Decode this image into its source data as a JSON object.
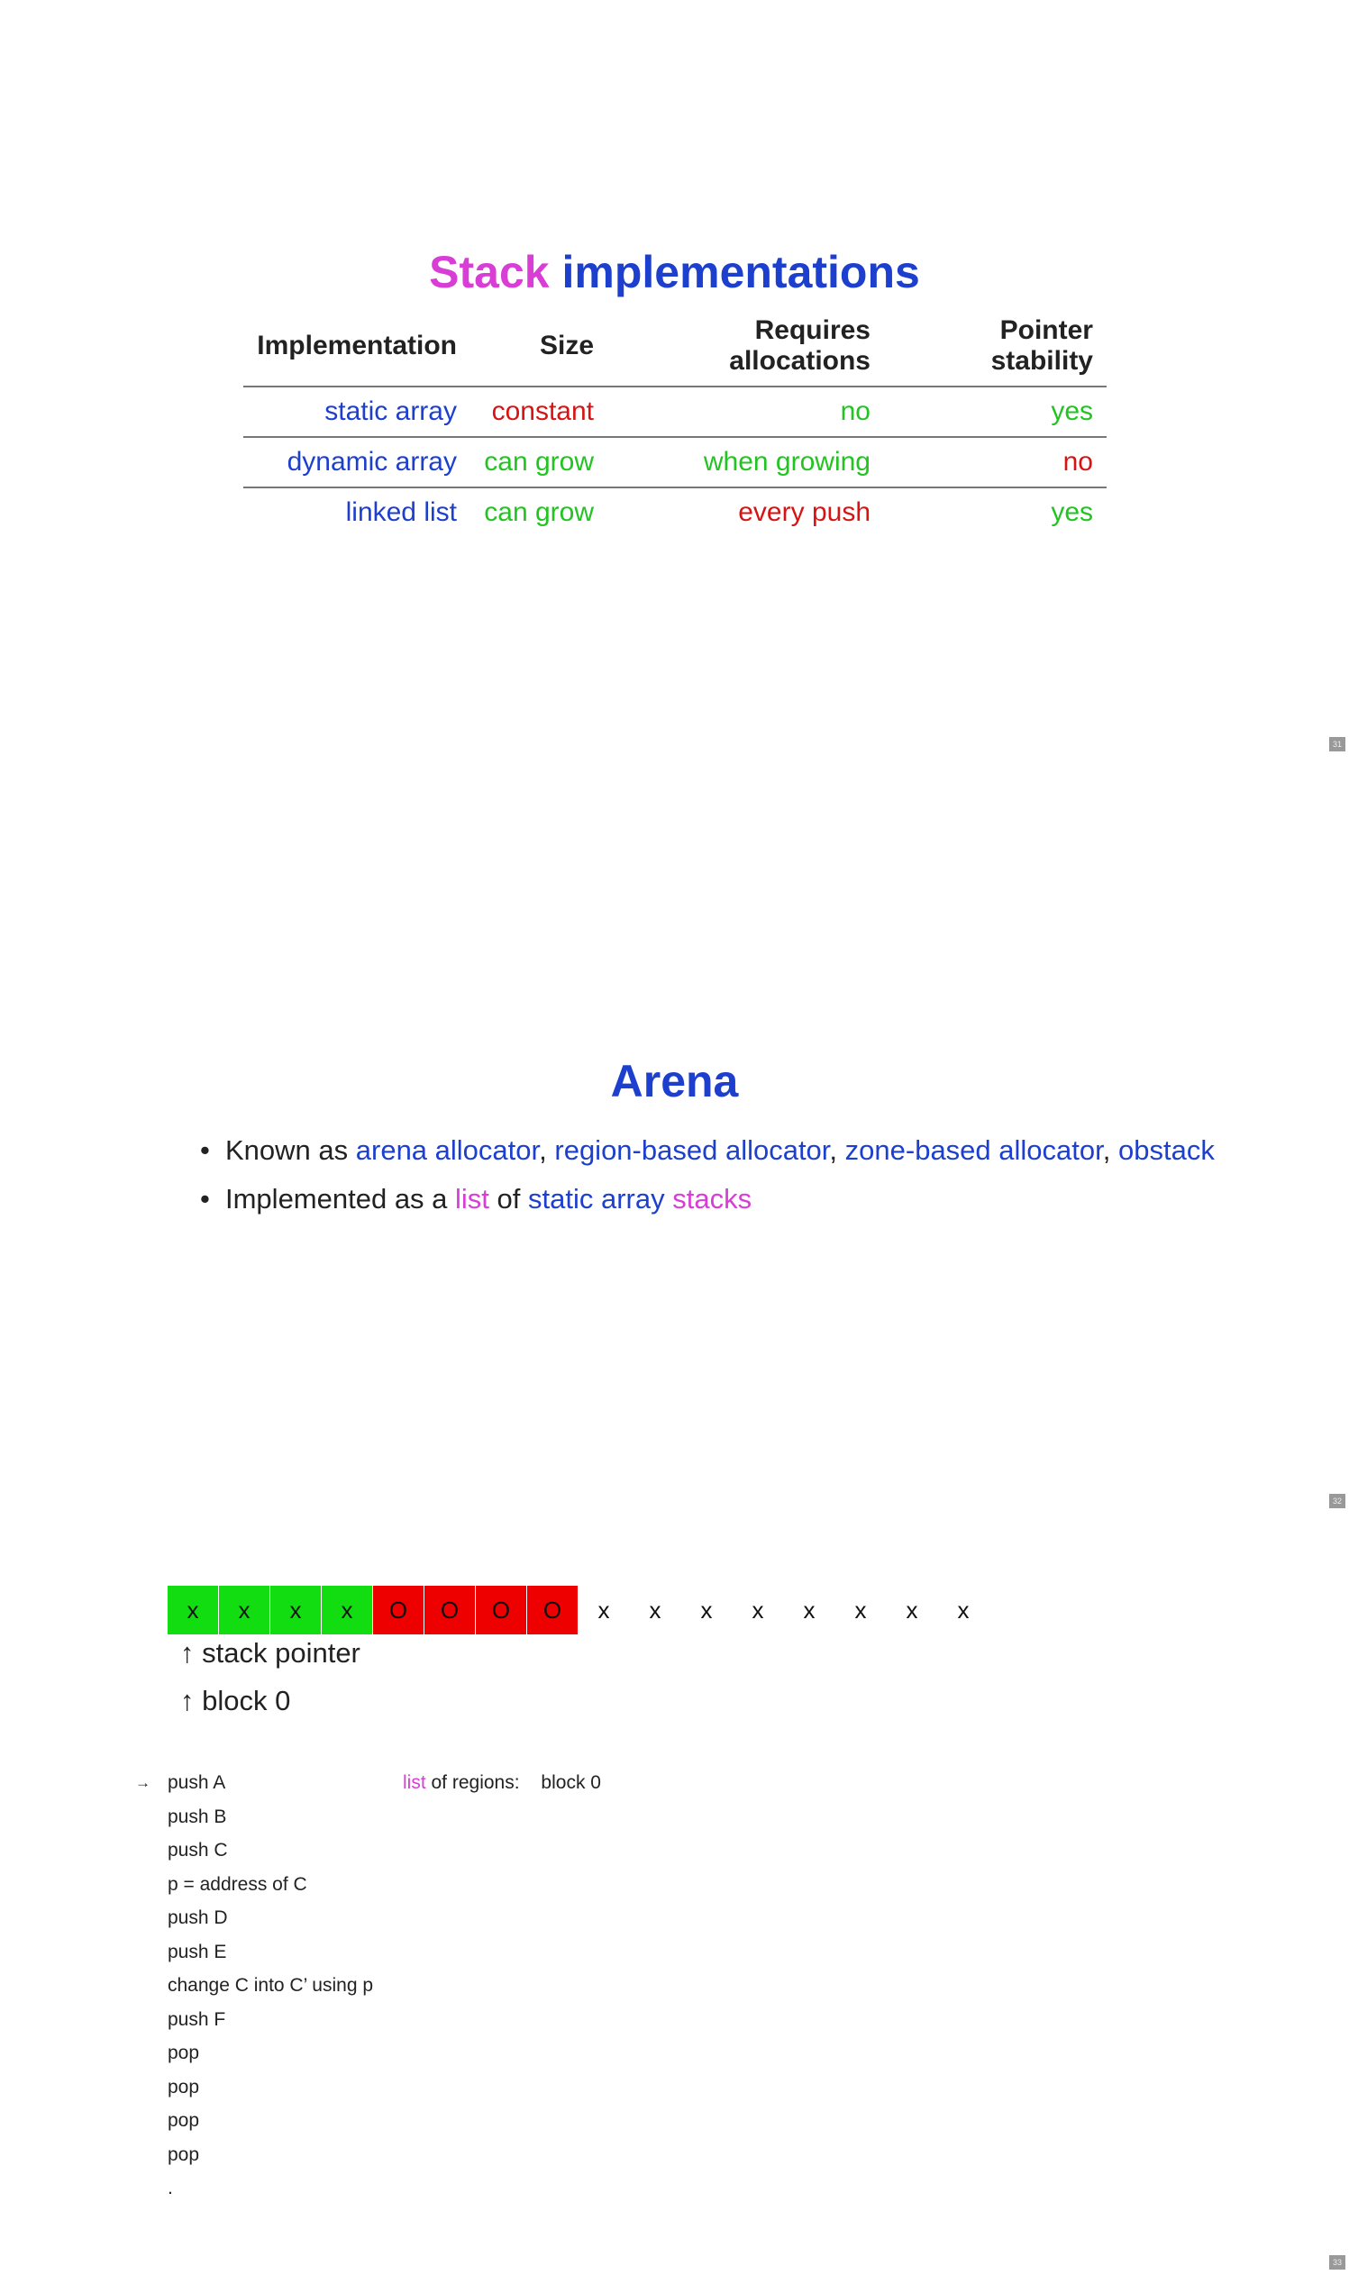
{
  "slides": [
    {
      "page_number": "31",
      "title_part1": "Stack",
      "title_part2": "implementations",
      "table": {
        "headers": [
          "Implementation",
          "Size",
          "Requires allocations",
          "Pointer stability"
        ],
        "rows": [
          [
            "static array",
            "constant",
            "no",
            "yes"
          ],
          [
            "dynamic array",
            "can grow",
            "when growing",
            "no"
          ],
          [
            "linked list",
            "can grow",
            "every push",
            "yes"
          ]
        ]
      }
    },
    {
      "page_number": "32",
      "title": "Arena",
      "bullet1": {
        "prefix": "Known as ",
        "term1": "arena allocator",
        "sep1": ", ",
        "term2": "region-based allocator",
        "sep2": ", ",
        "term3": "zone-based allocator",
        "sep3": ", ",
        "term4": "obstack"
      },
      "bullet2": {
        "prefix": "Implemented as a ",
        "term1": "list",
        "mid": " of ",
        "term2": "static array",
        "space": " ",
        "term3": "stacks"
      }
    },
    {
      "page_number": "33",
      "cells": [
        "x",
        "x",
        "x",
        "x",
        "O",
        "O",
        "O",
        "O",
        "x",
        "x",
        "x",
        "x",
        "x",
        "x",
        "x",
        "x"
      ],
      "cell_states": [
        "used",
        "used",
        "used",
        "used",
        "freed",
        "freed",
        "freed",
        "freed",
        "empty",
        "empty",
        "empty",
        "empty",
        "empty",
        "empty",
        "empty",
        "empty"
      ],
      "pointer_arrow": "↑",
      "stack_pointer_label": "stack pointer",
      "block_label": "block 0",
      "cursor": "→",
      "operations": [
        "push A",
        "push B",
        "push C",
        "p = address of C",
        "push D",
        "push E",
        "change C into C’ using p",
        "push F",
        "pop",
        "pop",
        "pop",
        "pop",
        "."
      ],
      "regions_term": "list",
      "regions_label": " of regions:",
      "regions_value": "block 0"
    }
  ],
  "colors": {
    "blue": "#1d3fce",
    "magenta": "#d83ed5",
    "green": "#22c422",
    "red": "#d61414",
    "used_cell": "#11dd11",
    "freed_cell": "#ee0000"
  }
}
